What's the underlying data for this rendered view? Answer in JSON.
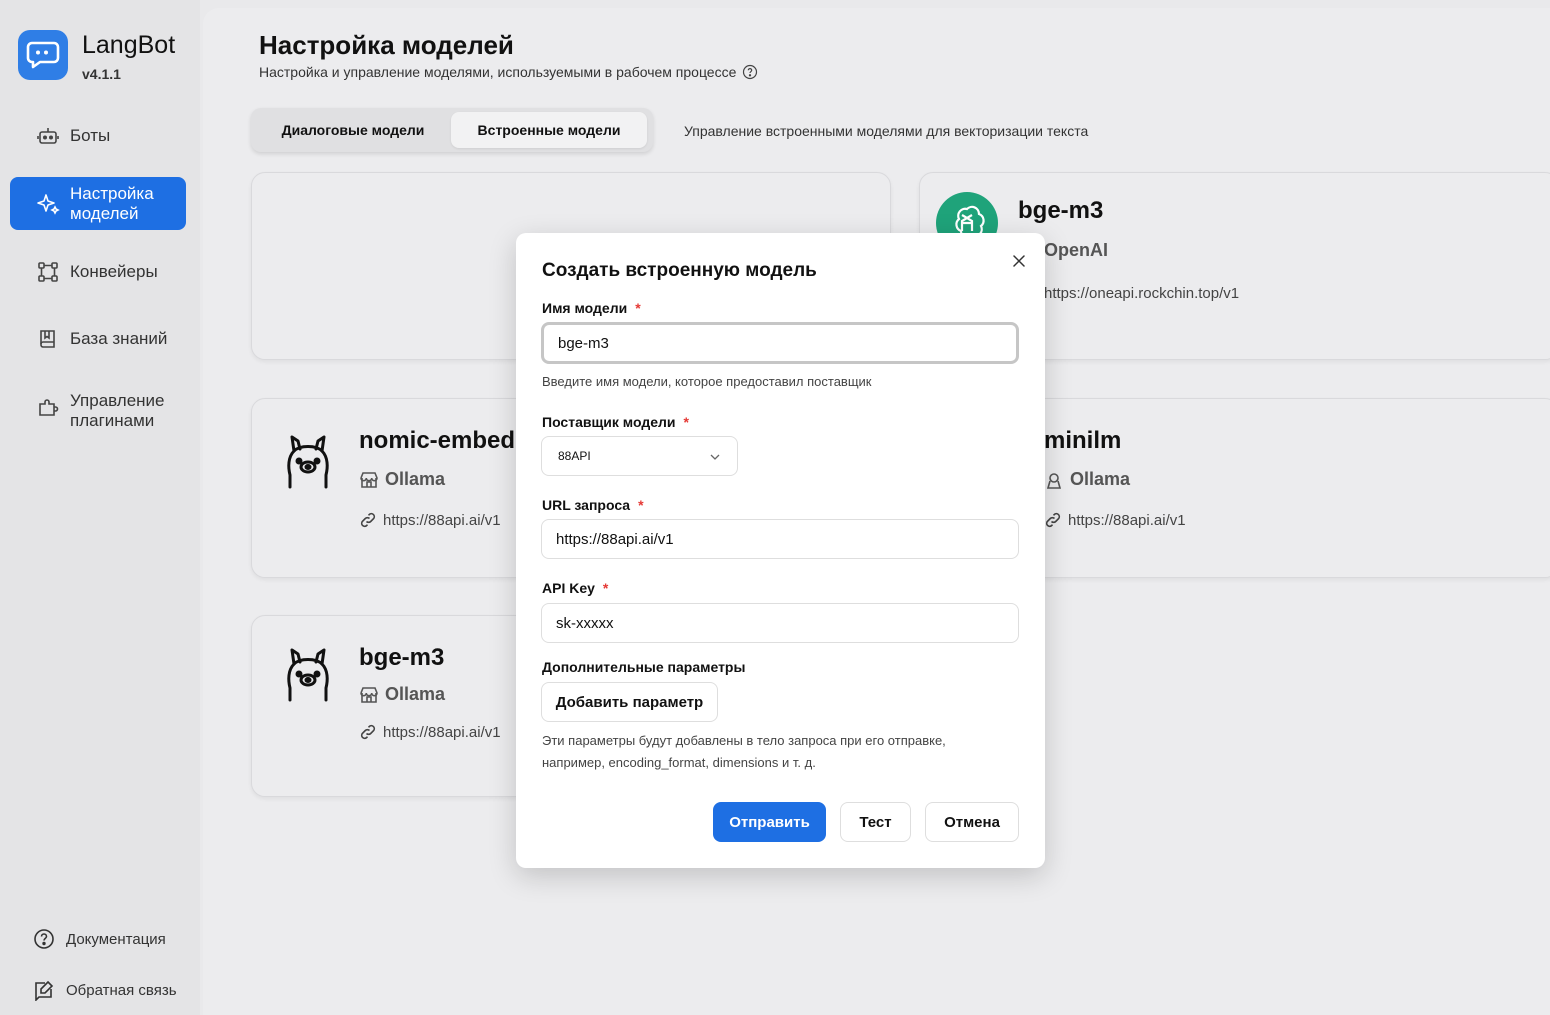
{
  "app": {
    "name": "LangBot",
    "version": "v4.1.1"
  },
  "sidebar": {
    "items": [
      {
        "label": "Боты",
        "icon": "bot-icon"
      },
      {
        "label": "Настройка моделей",
        "icon": "sparkle-icon",
        "active": true
      },
      {
        "label": "Конвейеры",
        "icon": "pipeline-icon"
      },
      {
        "label": "База знаний",
        "icon": "book-icon"
      },
      {
        "label": "Управление плагинами",
        "icon": "plugin-icon"
      }
    ],
    "bottom": [
      {
        "label": "Документация",
        "icon": "help-circle-icon"
      },
      {
        "label": "Обратная связь",
        "icon": "feedback-icon"
      }
    ]
  },
  "page": {
    "title": "Настройка моделей",
    "subtitle": "Настройка и управление моделями, используемыми в рабочем процессе",
    "tabs": [
      {
        "label": "Диалоговые модели"
      },
      {
        "label": "Встроенные модели",
        "active": true
      }
    ],
    "tab_description": "Управление встроенными моделями для векторизации текста"
  },
  "cards": [
    {
      "name": "bge-m3",
      "provider": "OpenAI",
      "url": "https://oneapi.rockchin.top/v1",
      "icon": "openai-icon"
    },
    {
      "name": "nomic-embed",
      "provider": "Ollama",
      "url": "https://88api.ai/v1",
      "icon": "ollama-icon"
    },
    {
      "name": "minilm",
      "provider": "Ollama",
      "url": "https://88api.ai/v1",
      "icon": "ollama-icon"
    },
    {
      "name": "bge-m3",
      "provider": "Ollama",
      "url": "https://88api.ai/v1",
      "icon": "ollama-icon"
    }
  ],
  "modal": {
    "title": "Создать встроенную модель",
    "model_name": {
      "label": "Имя модели",
      "value": "bge-m3",
      "hint": "Введите имя модели, которое предоставил поставщик"
    },
    "provider": {
      "label": "Поставщик модели",
      "value": "88API"
    },
    "url": {
      "label": "URL запроса",
      "value": "https://88api.ai/v1"
    },
    "api_key": {
      "label": "API Key",
      "value": "sk-xxxxx"
    },
    "extra": {
      "label": "Дополнительные параметры",
      "add_button": "Добавить параметр",
      "hint_line1": "Эти параметры будут добавлены в тело запроса при его отправке,",
      "hint_line2": "например, encoding_format, dimensions и т. д."
    },
    "required_mark": "*",
    "buttons": {
      "submit": "Отправить",
      "test": "Тест",
      "cancel": "Отмена"
    }
  },
  "colors": {
    "accent": "#1e6fe3",
    "required": "#e53935",
    "openai": "#1fa37a"
  }
}
